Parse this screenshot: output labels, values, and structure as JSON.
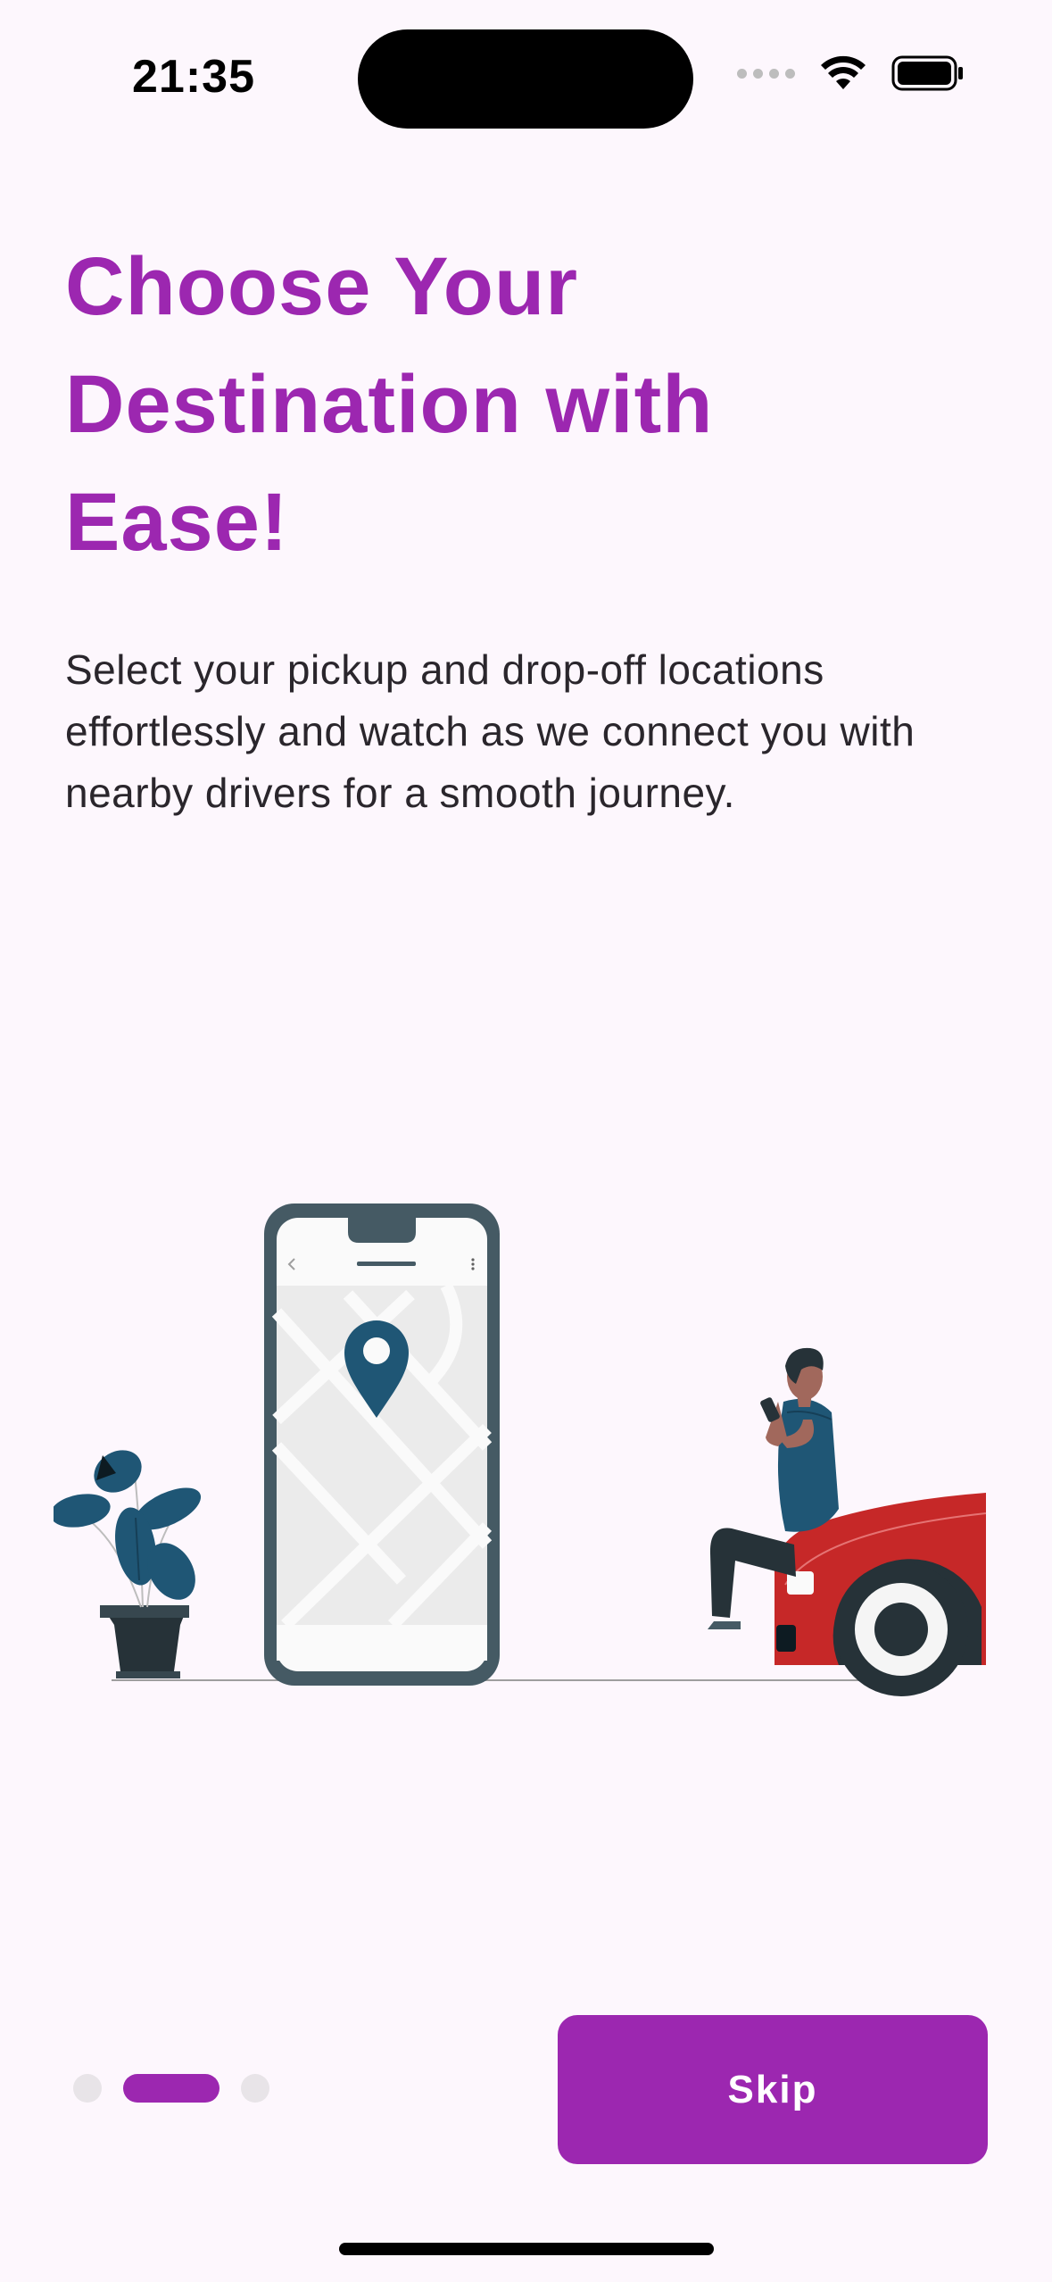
{
  "status_bar": {
    "time": "21:35",
    "icons": [
      "signal-icon",
      "wifi-icon",
      "battery-icon"
    ]
  },
  "onboarding": {
    "title": "Choose Your Destination with Ease!",
    "description": "Select your pickup and drop-off locations effortlessly and watch as we connect you with nearby drivers for a smooth journey.",
    "page_indicator": {
      "total_pages": 3,
      "current_page": 2
    },
    "skip_label": "Skip"
  },
  "colors": {
    "accent": "#9C27B0",
    "background": "#FDF7FD",
    "text": "#2A262C",
    "illustration_dark": "#455A64",
    "illustration_blue": "#1F5675",
    "car_red": "#C62828"
  }
}
